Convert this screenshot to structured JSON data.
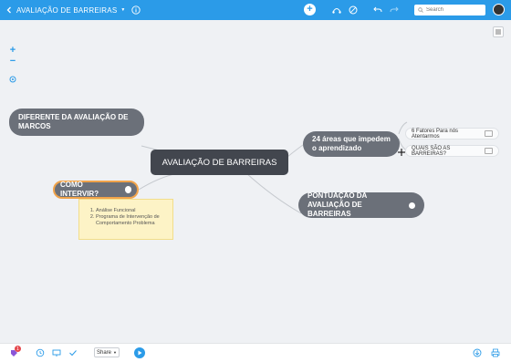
{
  "header": {
    "map_title": "AVALIAÇÃO DE BARREIRAS",
    "search_placeholder": "Search"
  },
  "map": {
    "central": "AVALIAÇÃO DE BARREIRAS",
    "topics": {
      "marcos": "DIFERENTE DA AVALIAÇÃO DE MARCOS",
      "intervir": "COMO INTERVIR?",
      "areas": "24 áreas que impedem o aprendizado",
      "pontuacao": "PONTUAÇÃO DA AVALIAÇÃO DE BARREIRAS"
    },
    "subtopics": {
      "fatores": "6 Fatores Para nós Atentarmos",
      "quais": "QUAIS SÃO AS BARREIRAS?"
    },
    "note_items": [
      "Análise Funcional",
      "Programa de Intervenção de Comportamento Problema"
    ]
  },
  "bottom": {
    "share_label": "Share",
    "notification_count": "1"
  },
  "colors": {
    "accent": "#2b9be8",
    "central_node": "#42464e",
    "topic_node": "#6b7079",
    "highlight": "#f0a34a"
  }
}
